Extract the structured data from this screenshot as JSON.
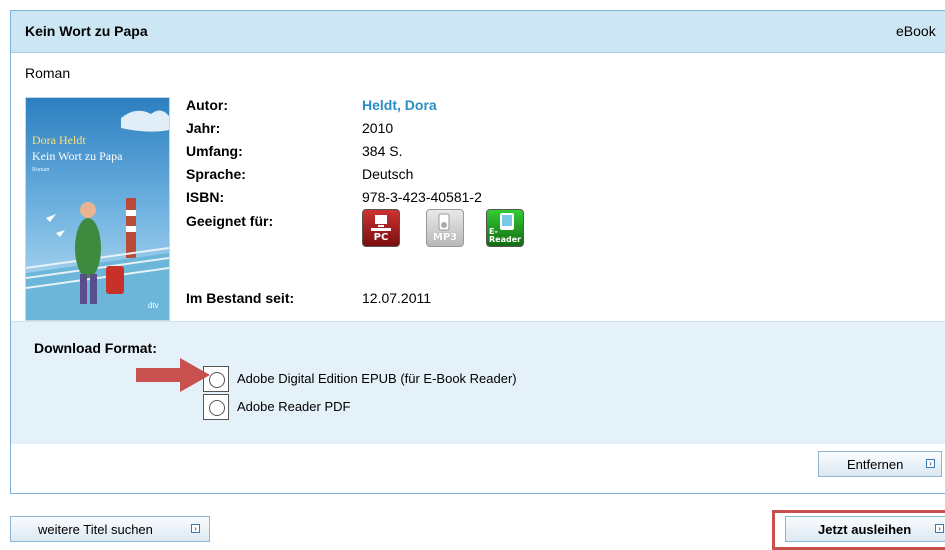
{
  "header": {
    "title": "Kein Wort zu Papa",
    "type": "eBook"
  },
  "subtitle": "Roman",
  "cover": {
    "author": "Dora Heldt",
    "title": "Kein Wort zu Papa",
    "genre": "Roman",
    "publisher": "dtv"
  },
  "details": {
    "author_label": "Autor:",
    "author_value": "Heldt, Dora",
    "year_label": "Jahr:",
    "year_value": "2010",
    "extent_label": "Umfang:",
    "extent_value": "384 S.",
    "language_label": "Sprache:",
    "language_value": "Deutsch",
    "isbn_label": "ISBN:",
    "isbn_value": "978-3-423-40581-2",
    "suitable_label": "Geeignet für:",
    "formats": [
      {
        "icon": "pc-icon",
        "label": "PC",
        "color": "#a31515"
      },
      {
        "icon": "mp3-icon",
        "label": "MP3",
        "color": "#c8c8c8"
      },
      {
        "icon": "ereader-icon",
        "label": "E-Reader",
        "color": "#1f8a1f"
      }
    ],
    "stock_label": "Im Bestand seit:",
    "stock_value": "12.07.2011"
  },
  "download": {
    "label": "Download Format:",
    "options": [
      {
        "label": "Adobe Digital Edition EPUB (für E-Book Reader)",
        "selected": false
      },
      {
        "label": "Adobe Reader PDF",
        "selected": false
      }
    ]
  },
  "buttons": {
    "remove": "Entfernen",
    "search_more": "weitere Titel suchen",
    "borrow": "Jetzt ausleihen"
  },
  "annotation_color": "#c8504f"
}
